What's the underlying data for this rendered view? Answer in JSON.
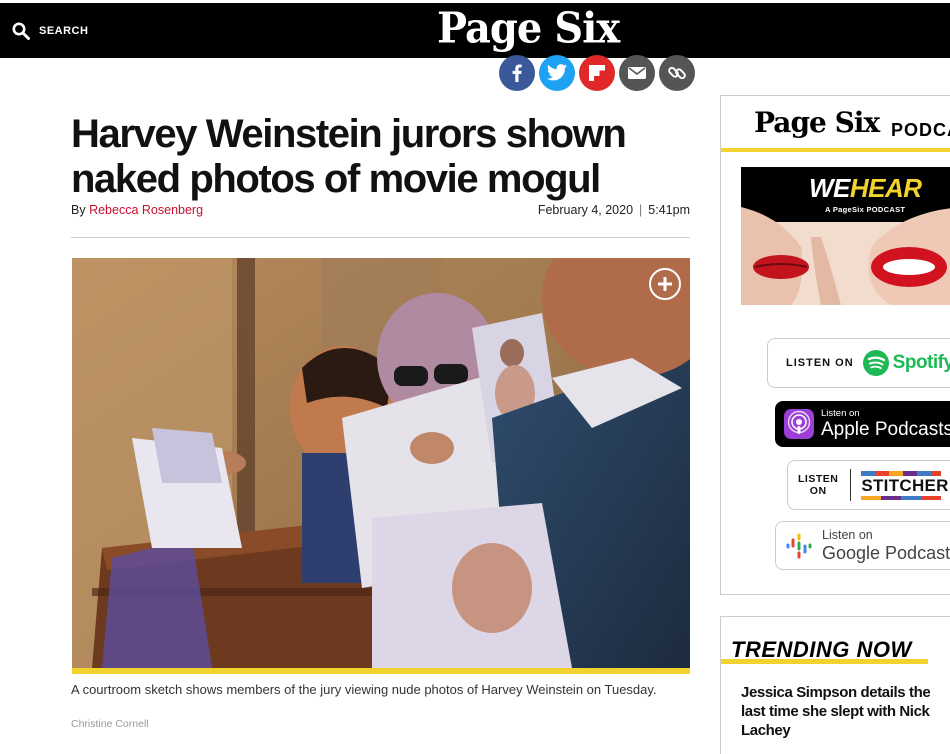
{
  "header": {
    "search_label": "SEARCH",
    "logo": "Page Six"
  },
  "share": {
    "icons": [
      "facebook-icon",
      "twitter-icon",
      "flipboard-icon",
      "email-icon",
      "link-icon"
    ],
    "colors": {
      "facebook": "#3b5998",
      "twitter": "#1da1f2",
      "flipboard": "#e12828",
      "email": "#555555",
      "link": "#555555"
    }
  },
  "article": {
    "headline": "Harvey Weinstein jurors shown naked photos of movie mogul",
    "by_prefix": "By",
    "author": "Rebecca Rosenberg",
    "date": "February 4, 2020",
    "separator": "|",
    "time": "5:41pm",
    "caption": "A courtroom sketch shows members of the jury viewing nude photos of Harvey Weinstein on Tuesday.",
    "credit": "Christine Cornell"
  },
  "sidebar": {
    "podcast_logo": "Page Six",
    "podcast_word": "PODCA",
    "banner": {
      "we": "WE",
      "hear": "HEAR",
      "sub": "A PageSix PODCAST"
    },
    "badges": {
      "spotify": {
        "listen": "LISTEN ON",
        "name": "Spotify"
      },
      "apple": {
        "listen": "Listen on",
        "name": "Apple Podcasts"
      },
      "stitcher": {
        "listen1": "LISTEN",
        "listen2": "ON",
        "name": "STITCHER"
      },
      "google": {
        "listen": "Listen on",
        "name": "Google Podcasts"
      }
    },
    "trending_title": "TRENDING NOW",
    "trending_items": [
      "Jessica Simpson details the last time she slept with Nick Lachey"
    ]
  },
  "colors": {
    "accent": "#f2d22e",
    "author_link": "#c8102e",
    "spotify_green": "#1db954"
  }
}
